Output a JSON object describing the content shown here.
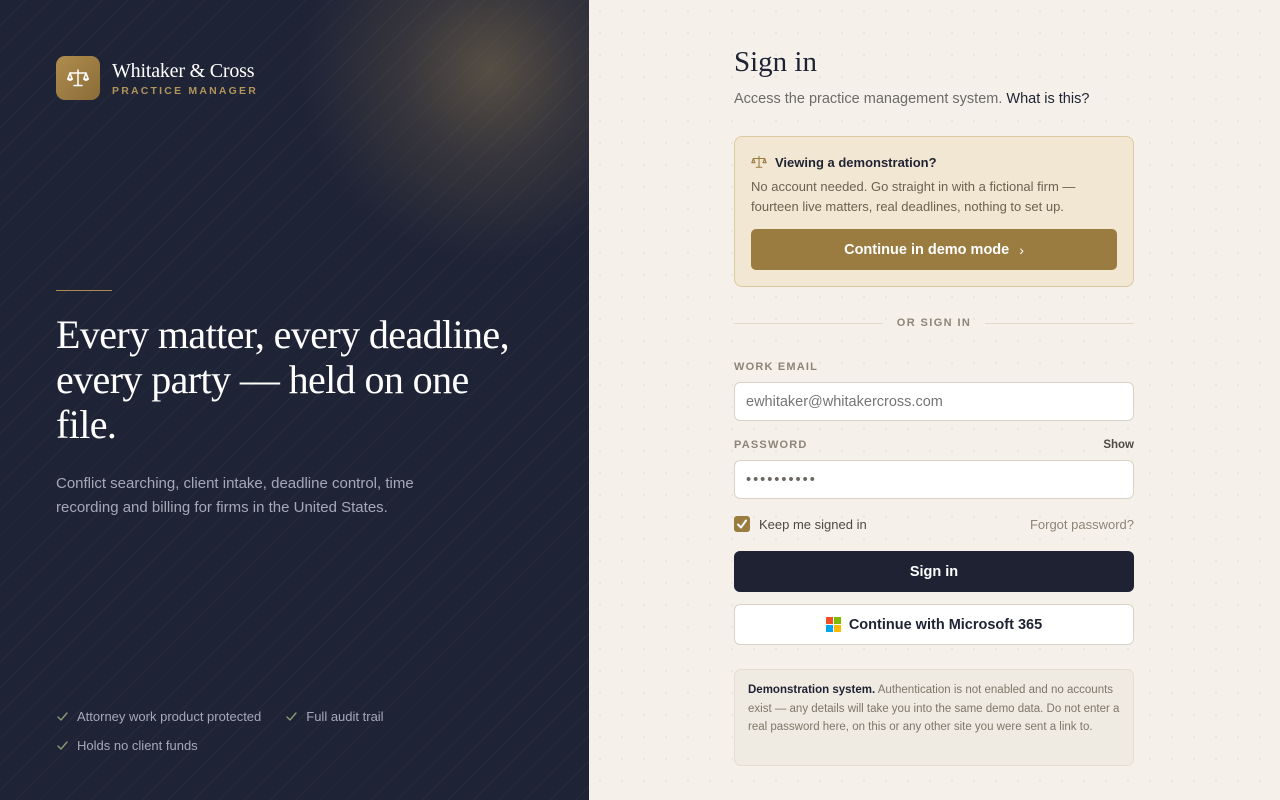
{
  "colors": {
    "navy": "#1f2336",
    "gold": "#9a7b40",
    "cream": "#f5f1ea",
    "demo_bg": "#f2e7d2"
  },
  "brand": {
    "name": "Whitaker & Cross",
    "subtitle": "PRACTICE MANAGER",
    "logo_icon": "scales-icon"
  },
  "hero": {
    "headline": "Every matter, every deadline, every party — held on one file.",
    "description": "Conflict searching, client intake, deadline control, time recording and billing for firms in the United States."
  },
  "features": [
    {
      "icon": "check-icon",
      "label": "Attorney work product protected"
    },
    {
      "icon": "check-icon",
      "label": "Full audit trail"
    },
    {
      "icon": "check-icon",
      "label": "Holds no client funds"
    }
  ],
  "signin": {
    "title": "Sign in",
    "subtitle": "Access the practice management system.",
    "what_link": "What is this?"
  },
  "demo": {
    "icon": "scales-icon",
    "heading": "Viewing a demonstration?",
    "body": "No account needed. Go straight in with a fictional firm — fourteen live matters, real deadlines, nothing to set up.",
    "button_label": "Continue in demo mode",
    "button_icon": "chevron-right-icon"
  },
  "divider_text": "OR SIGN IN",
  "form": {
    "email_label": "WORK EMAIL",
    "email_placeholder": "ewhitaker@whitakercross.com",
    "password_label": "PASSWORD",
    "show_label": "Show",
    "password_value": "••••••••••",
    "remember_label": "Keep me signed in",
    "remember_checked": true,
    "forgot_label": "Forgot password?",
    "signin_button": "Sign in",
    "microsoft_button": "Continue with Microsoft 365",
    "microsoft_icon": "microsoft-icon"
  },
  "notice": {
    "title": "Demonstration system.",
    "body": "Authentication is not enabled and no accounts exist — any details will take you into the same demo data. Do not enter a real password here, on this or any other site you were sent a link to."
  }
}
